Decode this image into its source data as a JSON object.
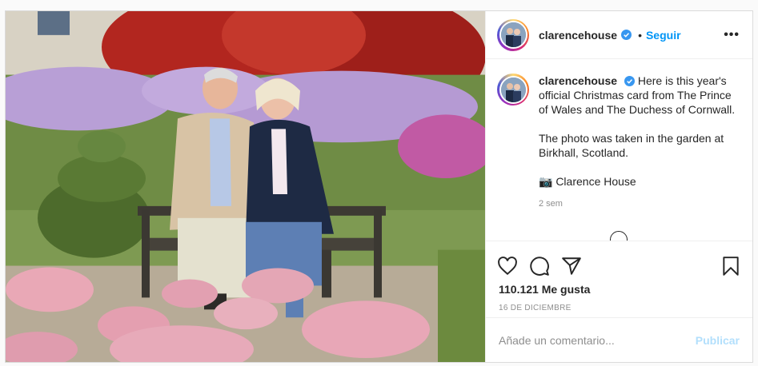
{
  "post": {
    "username": "clarencehouse",
    "dot": "•",
    "follow_label": "Seguir",
    "more_label": "•••",
    "caption": {
      "username": "clarencehouse",
      "line1": "Here is this year's official Christmas card from The Prince of Wales and The Duchess of Cornwall.",
      "line2": "The photo was taken in the garden at Birkhall, Scotland.",
      "line3": "📷 Clarence House"
    },
    "time": "2 sem",
    "likes": "110.121 Me gusta",
    "date": "16 DE DICIEMBRE",
    "comment_placeholder": "Añade un comentario...",
    "publish_label": "Publicar"
  },
  "icons": {
    "verified": "verified-badge-icon",
    "like": "heart-icon",
    "comment": "comment-icon",
    "share": "paper-plane-icon",
    "save": "bookmark-icon"
  },
  "colors": {
    "accent": "#0095f6",
    "publish_disabled": "#b2dffc",
    "muted": "#8e8e8e"
  }
}
